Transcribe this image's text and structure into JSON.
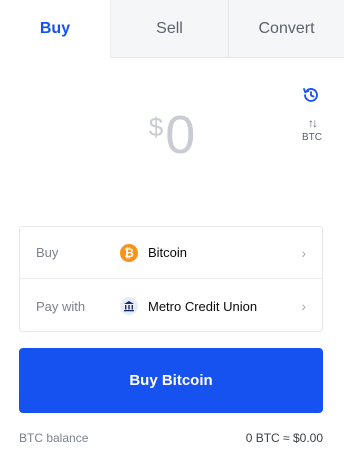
{
  "tabs": [
    {
      "label": "Buy",
      "active": true
    },
    {
      "label": "Sell",
      "active": false
    },
    {
      "label": "Convert",
      "active": false
    }
  ],
  "amount": {
    "currency_symbol": "$",
    "value": "0"
  },
  "swap": {
    "label": "BTC",
    "icon": "swap-arrows-icon"
  },
  "history_icon": "clock-history-icon",
  "order": {
    "buy": {
      "label": "Buy",
      "asset": "Bitcoin",
      "icon": "bitcoin-icon",
      "icon_color": "#f7931a"
    },
    "pay_with": {
      "label": "Pay with",
      "method": "Metro Credit Union",
      "icon": "bank-icon"
    }
  },
  "cta": {
    "label": "Buy Bitcoin",
    "color": "#1652f0"
  },
  "balance": {
    "label": "BTC balance",
    "value": "0 BTC  ≈ $0.00"
  },
  "colors": {
    "accent": "#1652f0",
    "bitcoin": "#f7931a"
  }
}
